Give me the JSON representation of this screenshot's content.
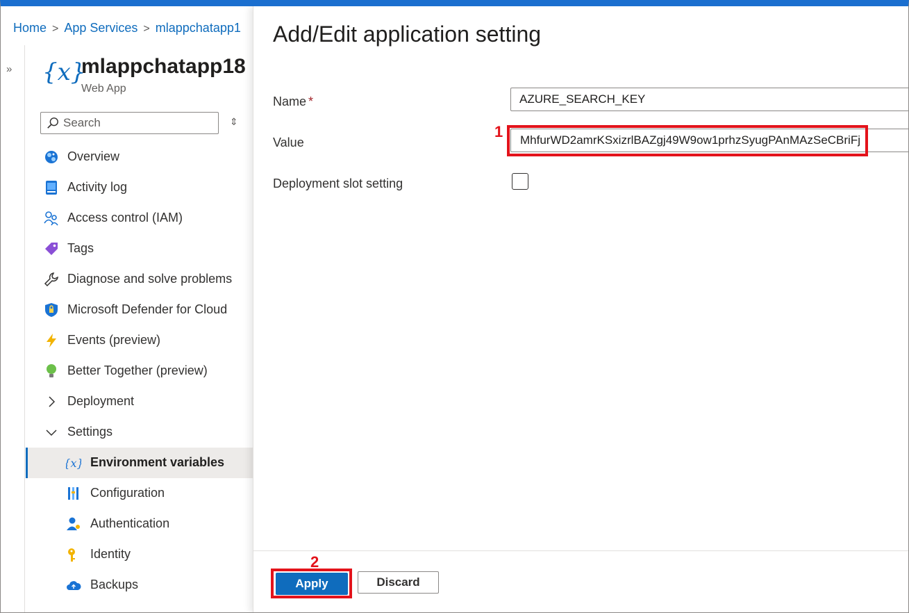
{
  "breadcrumb": {
    "items": [
      "Home",
      "App Services",
      "mlappchatapp1"
    ]
  },
  "resource": {
    "name": "mlappchatapp18",
    "type": "Web App"
  },
  "search": {
    "placeholder": "Search"
  },
  "nav": {
    "items": [
      {
        "label": "Overview",
        "icon": "globe-icon"
      },
      {
        "label": "Activity log",
        "icon": "log-icon"
      },
      {
        "label": "Access control (IAM)",
        "icon": "people-icon"
      },
      {
        "label": "Tags",
        "icon": "tag-icon"
      },
      {
        "label": "Diagnose and solve problems",
        "icon": "wrench-icon"
      },
      {
        "label": "Microsoft Defender for Cloud",
        "icon": "shield-icon"
      },
      {
        "label": "Events (preview)",
        "icon": "lightning-icon"
      },
      {
        "label": "Better Together (preview)",
        "icon": "lightbulb-icon"
      },
      {
        "label": "Deployment",
        "icon": "chevron-right-icon"
      },
      {
        "label": "Settings",
        "icon": "chevron-down-icon"
      },
      {
        "label": "Environment variables",
        "icon": "variable-icon"
      },
      {
        "label": "Configuration",
        "icon": "config-bars-icon"
      },
      {
        "label": "Authentication",
        "icon": "user-key-icon"
      },
      {
        "label": "Identity",
        "icon": "key-icon"
      },
      {
        "label": "Backups",
        "icon": "cloud-icon"
      }
    ]
  },
  "blade": {
    "title": "Add/Edit application setting",
    "name_label": "Name",
    "required_mark": "*",
    "name_value": "AZURE_SEARCH_KEY",
    "value_label": "Value",
    "value_value": "MhfurWD2amrKSxizrlBAZgj49W9ow1prhzSyugPAnMAzSeCBriFj",
    "slot_label": "Deployment slot setting",
    "slot_checked": false
  },
  "footer": {
    "apply_label": "Apply",
    "discard_label": "Discard"
  },
  "annotations": {
    "marker_1": "1",
    "marker_2": "2",
    "highlight_color": "#e3131b"
  },
  "colors": {
    "accent": "#0f6cbd",
    "top_bar": "#1b6fcf"
  }
}
